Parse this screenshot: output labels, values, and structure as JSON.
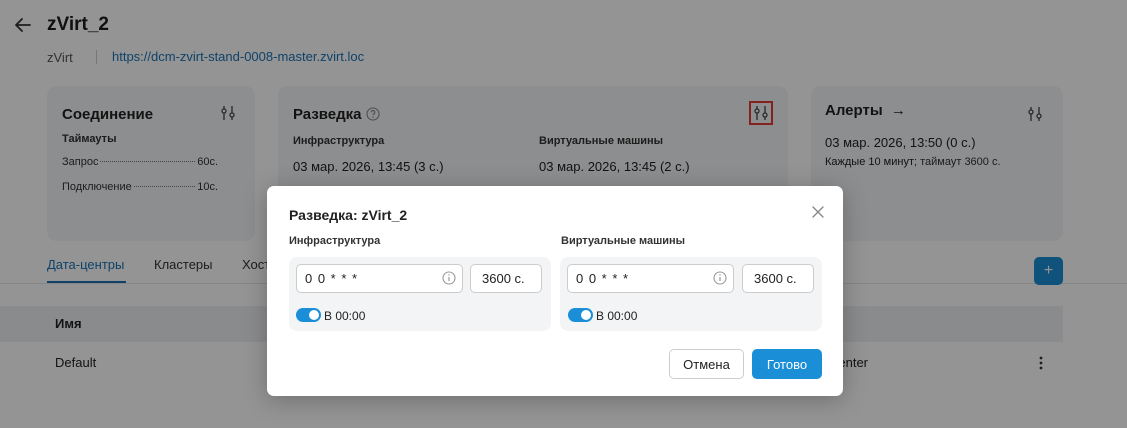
{
  "header": {
    "title": "zVirt_2",
    "type": "zVirt",
    "url": "https://dcm-zvirt-stand-0008-master.zvirt.loc"
  },
  "connection": {
    "title": "Соединение",
    "timeouts_label": "Таймауты",
    "request_label": "Запрос",
    "request_value": "60с.",
    "connect_label": "Подключение",
    "connect_value": "10с."
  },
  "discovery": {
    "title": "Разведка",
    "infra_label": "Инфраструктура",
    "infra_value": "03 мар. 2026, 13:45 (3 с.)",
    "vm_label": "Виртуальные машины",
    "vm_value": "03 мар. 2026, 13:45 (2 с.)"
  },
  "alerts": {
    "title": "Алерты",
    "arrow": "→",
    "value": "03 мар. 2026, 13:50 (0 с.)",
    "schedule_prefix": "Каждые 10 минут",
    "schedule_suffix": "; таймаут 3600 с."
  },
  "tabs": [
    {
      "label": "Дата-центры",
      "active": true
    },
    {
      "label": "Кластеры",
      "active": false
    },
    {
      "label": "Хосты",
      "active": false
    }
  ],
  "add_button": "+",
  "table": {
    "header_name": "Имя",
    "row_name": "Default",
    "row_right": "Datacenter"
  },
  "modal": {
    "title": "Разведка: zVirt_2",
    "close_icon": "close-icon",
    "infra": {
      "label": "Инфраструктура",
      "cron": "0 0 * * *",
      "timeout": "3600 с.",
      "toggle_label": "В 00:00",
      "toggle_on": true
    },
    "vm": {
      "label": "Виртуальные машины",
      "cron": "0 0 * * *",
      "timeout": "3600 с.",
      "toggle_label": "В 00:00",
      "toggle_on": true
    },
    "cancel_label": "Отмена",
    "ok_label": "Готово"
  },
  "colors": {
    "accent": "#1a8fd8",
    "link": "#1a73b5",
    "highlight": "#e53935"
  }
}
